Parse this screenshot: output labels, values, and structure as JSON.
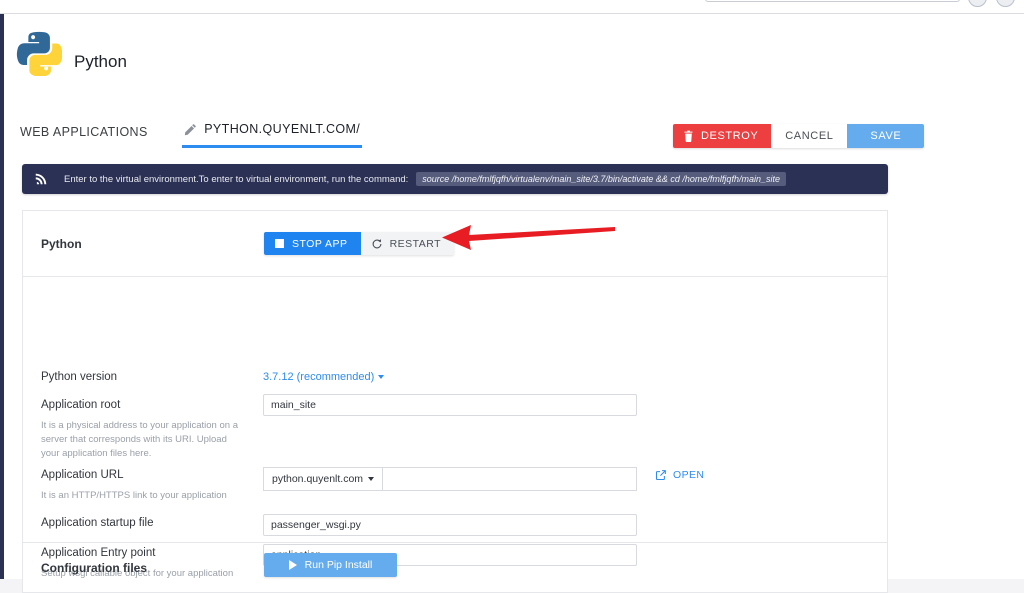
{
  "browser": {
    "search_icon": "search-box",
    "circle_icons": [
      "profile-circle-icon",
      "menu-circle-icon"
    ]
  },
  "header": {
    "logo": "python-logo",
    "title": "Python"
  },
  "tabs": [
    {
      "label": "WEB APPLICATIONS",
      "active": false,
      "icon": ""
    },
    {
      "label": "PYTHON.QUYENLT.COM/",
      "active": true,
      "icon": "pencil-icon"
    }
  ],
  "top_actions": {
    "destroy_label": "DESTROY",
    "destroy_icon": "trash-icon",
    "cancel_label": "CANCEL",
    "save_label": "SAVE",
    "destroy_color": "#ed3f3f",
    "save_color": "#64aced"
  },
  "notice": {
    "icon": "broadcast-icon",
    "text": "Enter to the virtual environment.To enter to virtual environment, run the command:",
    "command": "source /home/fmlfjqfh/virtualenv/main_site/3.7/bin/activate && cd /home/fmlfjqfh/main_site",
    "background": "#2b3155"
  },
  "app_row": {
    "name": "Python",
    "stop_label": "STOP APP",
    "stop_icon": "stop-square-icon",
    "restart_label": "RESTART",
    "restart_icon": "restart-arrow-icon",
    "stop_color": "#1f84ef"
  },
  "annotation": {
    "type": "red-arrow-left",
    "color": "#e81d23"
  },
  "form": {
    "python_version": {
      "label": "Python version",
      "value": "3.7.12 (recommended)",
      "caret": "chevron-down-icon"
    },
    "application_root": {
      "label": "Application root",
      "value": "main_site",
      "help": "It is a physical address to your application on a server that corresponds with its URI. Upload your application files here."
    },
    "application_url": {
      "label": "Application URL",
      "help": "It is an HTTP/HTTPS link to your application",
      "domain": "python.quyenlt.com",
      "path_value": "",
      "path_placeholder": "",
      "open_label": "OPEN",
      "open_icon": "external-link-icon"
    },
    "startup_file": {
      "label": "Application startup file",
      "value": "passenger_wsgi.py"
    },
    "entry_point": {
      "label": "Application Entry point",
      "value": "application",
      "help": "Setup wsgi callable object for your application"
    }
  },
  "config_row": {
    "label": "Configuration files",
    "pip_label": "Run Pip Install",
    "pip_icon": "play-icon"
  }
}
